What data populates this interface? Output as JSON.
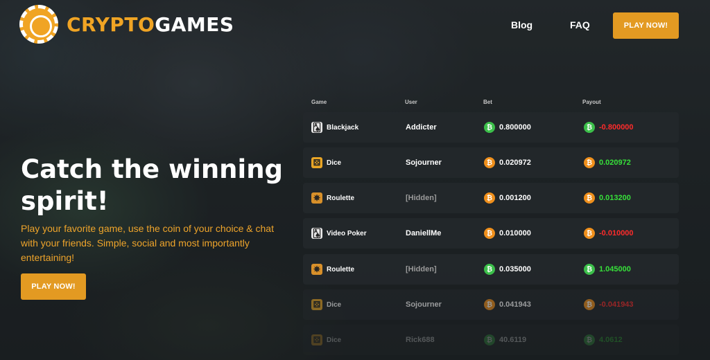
{
  "brand": {
    "part1": "CRYPTO",
    "part2": "GAMES"
  },
  "nav": {
    "blog": "Blog",
    "faq": "FAQ",
    "play": "PLAY NOW!"
  },
  "hero": {
    "title": "Catch the winning spirit!",
    "subtitle": "Play your favorite game, use the coin of your choice & chat with your friends. Simple, social and most importantly entertaining!",
    "button": "PLAY NOW!"
  },
  "table": {
    "headers": {
      "game": "Game",
      "user": "User",
      "bet": "Bet",
      "payout": "Payout"
    },
    "coin_symbol": "₿",
    "rows": [
      {
        "game": "Blackjack",
        "icon": "cards-icon",
        "user": "Addicter",
        "bet": "0.800000",
        "payout": "-0.800000",
        "coin": "green",
        "payout_status": "loss"
      },
      {
        "game": "Dice",
        "icon": "dice-icon",
        "user": "Sojourner",
        "bet": "0.020972",
        "payout": "0.020972",
        "coin": "orange",
        "payout_status": "win"
      },
      {
        "game": "Roulette",
        "icon": "roulette-icon",
        "user": "[Hidden]",
        "bet": "0.001200",
        "payout": "0.013200",
        "coin": "orange",
        "payout_status": "win"
      },
      {
        "game": "Video Poker",
        "icon": "cards-icon",
        "user": "DaniellMe",
        "bet": "0.010000",
        "payout": "-0.010000",
        "coin": "orange",
        "payout_status": "loss"
      },
      {
        "game": "Roulette",
        "icon": "roulette-icon",
        "user": "[Hidden]",
        "bet": "0.035000",
        "payout": "1.045000",
        "coin": "green",
        "payout_status": "win"
      },
      {
        "game": "Dice",
        "icon": "dice-icon",
        "user": "Sojourner",
        "bet": "0.041943",
        "payout": "-0.041943",
        "coin": "orange",
        "payout_status": "loss"
      },
      {
        "game": "Dice",
        "icon": "dice-icon",
        "user": "Rick688",
        "bet": "40.6119",
        "payout": "4.0612",
        "coin": "green",
        "payout_status": "win"
      }
    ]
  },
  "colors": {
    "accent": "#e39a22",
    "coin_green": "#3cbf4a",
    "coin_orange": "#f0901c",
    "win": "#37e13a",
    "loss": "#ff2b2b"
  }
}
